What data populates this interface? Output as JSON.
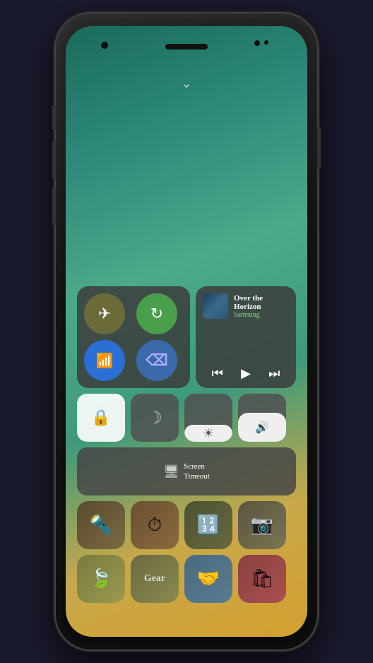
{
  "phone": {
    "media": {
      "title": "Over the Horizon",
      "artist": "Samsung"
    },
    "controls": {
      "screen_timeout_label": "Screen\nTimeout",
      "screen_timeout_line1": "Screen",
      "screen_timeout_line2": "Timeout"
    },
    "connectivity": {
      "airplane_label": "Airplane Mode",
      "rotation_label": "Auto Rotate",
      "wifi_label": "WiFi",
      "bluetooth_label": "Bluetooth"
    },
    "utilities": {
      "lock_label": "Screen Lock Rotation",
      "night_label": "Night Mode",
      "brightness_label": "Brightness",
      "volume_label": "Volume"
    },
    "apps_row1": {
      "torch": "Torch",
      "timer": "Timer",
      "calculator": "Calculator",
      "camera": "Camera"
    },
    "apps_row2": {
      "power_saving": "Power Saving",
      "gear": "Gear",
      "connect": "Quick Connect",
      "store": "Galaxy Store"
    }
  }
}
